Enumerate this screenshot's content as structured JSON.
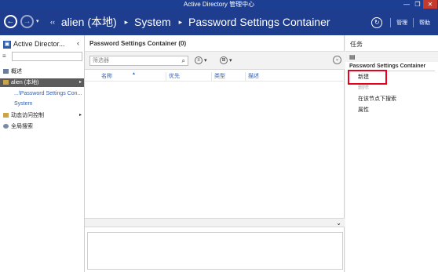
{
  "window": {
    "title": "Active Directory 管理中心",
    "min_symbol": "—",
    "max_symbol": "❐",
    "close_symbol": "✕"
  },
  "nav": {
    "back_symbol": "←",
    "forward_symbol": "→",
    "dropdown_symbol": "▾",
    "breadcrumb": [
      "alien (本地)",
      "System",
      "Password Settings Container"
    ],
    "crumb_prefix": "‹‹",
    "crumb_sep": "▸",
    "refresh_symbol": "↻",
    "manage_label": "管理",
    "help_label": "帮助"
  },
  "left_pane": {
    "title": "Active Director...",
    "collapse_symbol": "‹",
    "filter_icon": "≡",
    "filter_placeholder": "",
    "items": [
      {
        "label": "概述"
      },
      {
        "label": "alien (本地)",
        "arrow": "▸"
      },
      {
        "label": "...\\Password Settings Con..."
      },
      {
        "label": "System"
      },
      {
        "label": "动态访问控制",
        "arrow": "▸"
      },
      {
        "label": "全局搜索"
      }
    ]
  },
  "center_pane": {
    "header": "Password Settings Container  (0)",
    "filter_placeholder": "筛选器",
    "search_symbol": "⌕",
    "btn1_icon": "≡",
    "btn2_icon": "⊞",
    "dropdown_symbol": "▾",
    "expand_symbol": "⌄",
    "sort_arrow": "▲",
    "columns": [
      "名称",
      "优先",
      "类型",
      "描述"
    ],
    "split_chevron": "⌄"
  },
  "right_pane": {
    "title": "任务",
    "toolbar_icon": "▤",
    "section": "Password Settings Container",
    "tasks": [
      {
        "label": "新建",
        "enabled": true
      },
      {
        "label": "删除",
        "enabled": false
      },
      {
        "label": "在该节点下搜索",
        "enabled": true
      },
      {
        "label": "属性",
        "enabled": true
      }
    ]
  },
  "colors": {
    "titlebar": "#1c3f93",
    "navbar": "#1e3d8f",
    "selected": "#5b5b5b",
    "link": "#2f5fb6",
    "highlight": "#e8001c"
  }
}
